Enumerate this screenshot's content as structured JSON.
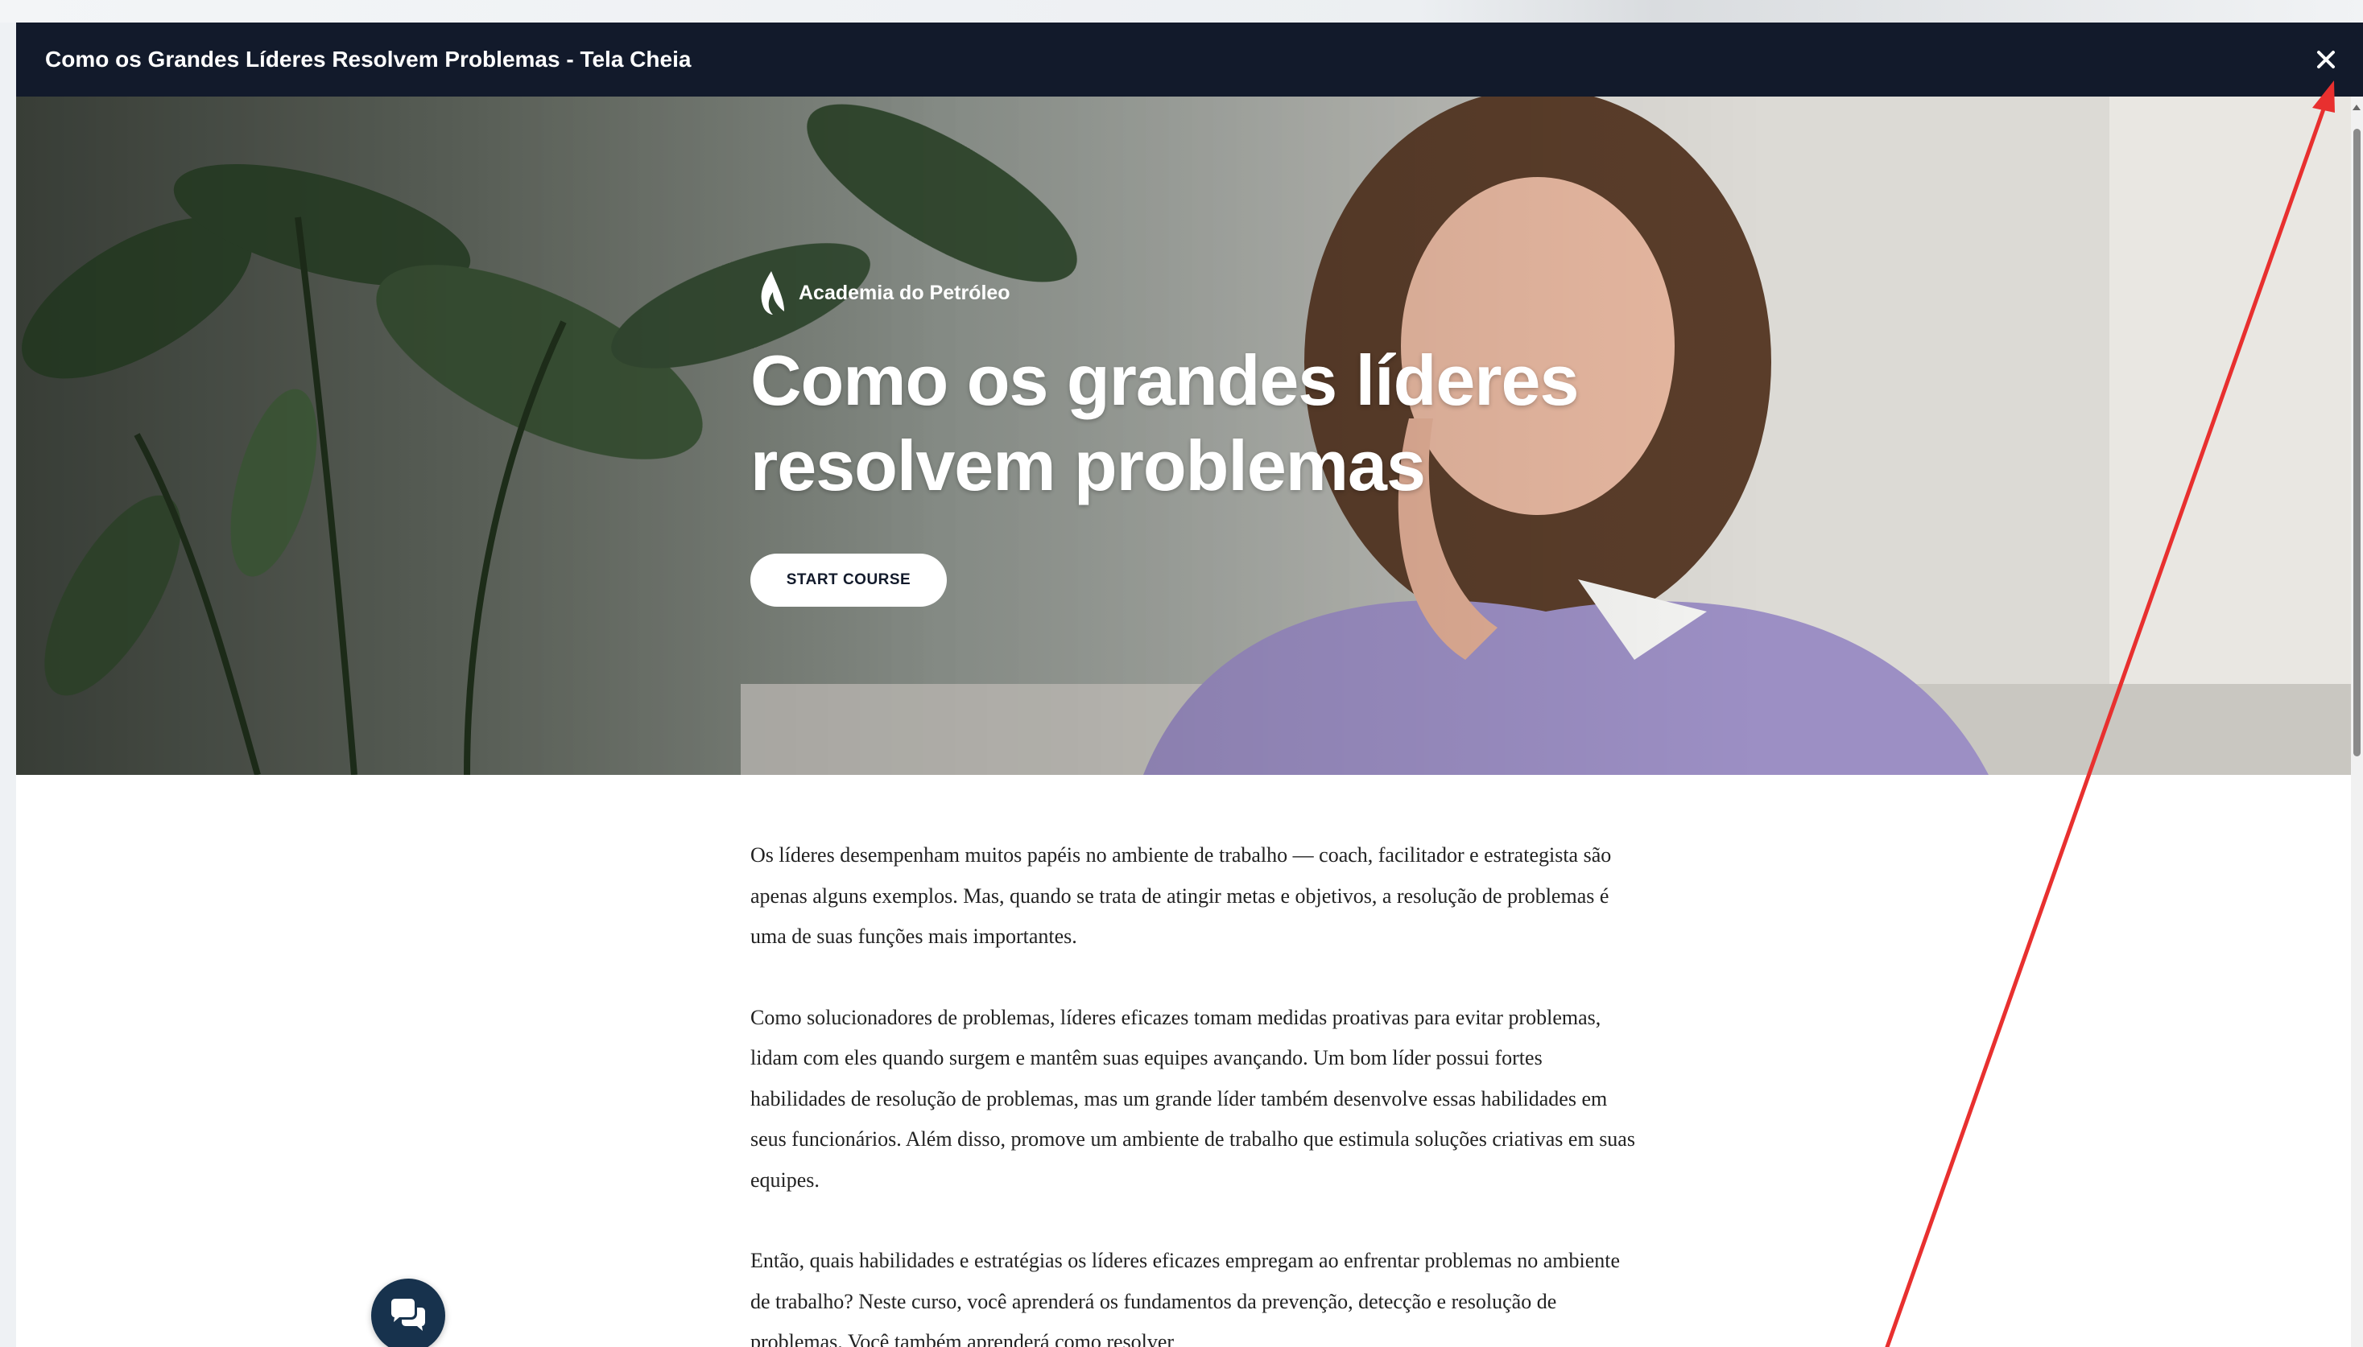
{
  "window": {
    "title": "Como os Grandes Líderes Resolvem Problemas - Tela Cheia",
    "close_icon": "close-icon"
  },
  "hero": {
    "brand_name": "Academia do Petróleo",
    "brand_icon": "flame-logo-icon",
    "title_line1": "Como os grandes líderes",
    "title_line2": "resolvem problemas",
    "start_button": "START COURSE"
  },
  "content": {
    "paragraphs": [
      "Os líderes desempenham muitos papéis no ambiente de trabalho — coach, facilitador e estrategista são apenas alguns exemplos. Mas, quando se trata de atingir metas e objetivos, a resolução de problemas é uma de suas funções mais importantes.",
      "Como solucionadores de problemas, líderes eficazes tomam medidas proativas para evitar problemas, lidam com eles quando surgem e mantêm suas equipes avançando. Um bom líder possui fortes habilidades de resolução de problemas, mas um grande líder também desenvolve essas habilidades em seus funcionários. Além disso, promove um ambiente de trabalho que estimula soluções criativas em suas equipes.",
      "Então, quais habilidades e estratégias os líderes eficazes empregam ao enfrentar problemas no ambiente de trabalho? Neste curso, você aprenderá os fundamentos da prevenção, detecção e resolução de problemas. Você também aprenderá como resolver"
    ]
  },
  "chat": {
    "icon": "chat-bubbles-icon"
  },
  "colors": {
    "titlebar": "#121a2b",
    "annotation_arrow": "#e8302f",
    "chat_button": "#17324d"
  }
}
